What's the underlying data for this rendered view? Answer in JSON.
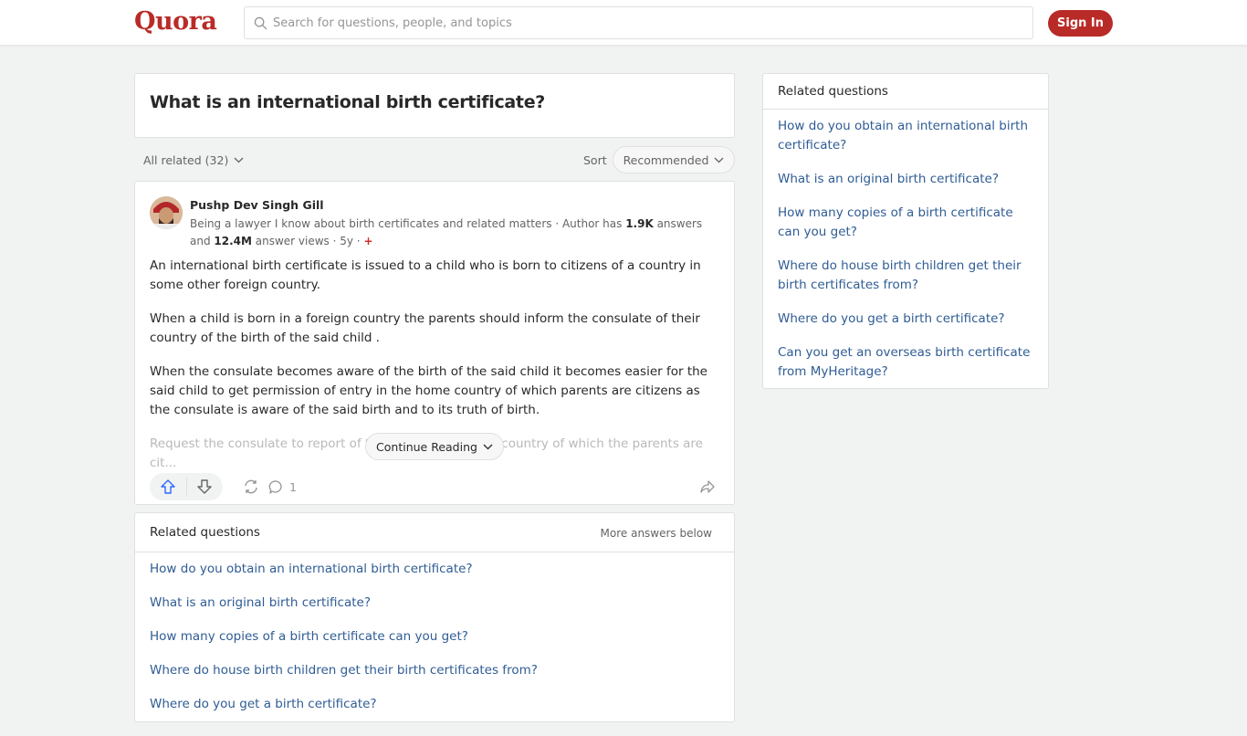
{
  "header": {
    "logo": "Quora",
    "search_placeholder": "Search for questions, people, and topics",
    "signin_label": "Sign In"
  },
  "question": {
    "title": "What is an international birth certificate?"
  },
  "filters": {
    "all_related": "All related (32)",
    "sort_label": "Sort",
    "sort_value": "Recommended"
  },
  "answer": {
    "author": "Pushp Dev Singh Gill",
    "credential_prefix": "Being a lawyer I know about birth certificates and related matters · Author has ",
    "answers_count": "1.9K",
    "credential_mid": " answers and ",
    "views_count": "12.4M",
    "credential_suffix": " answer views · 5y · ",
    "plus_badge": "+",
    "paragraphs": [
      "An international birth certificate is issued to a child who is born to citizens of a country in some other foreign country.",
      "When a child is born in a foreign country the parents should inform the consulate of their country of the birth of the said child .",
      "When the consulate becomes aware of the birth of the said child it becomes easier for the said child to get permission of entry in the home country of which parents are citizens as the consulate is aware of the said birth and to its truth of birth.",
      "Request the consulate to report of the birth to the home country of which the parents are cit..."
    ],
    "continue_label": "Continue Reading",
    "comment_count": "1"
  },
  "related_inline": {
    "title": "Related questions",
    "more": "More answers below",
    "items": [
      "How do you obtain an international birth certificate?",
      "What is an original birth certificate?",
      "How many copies of a birth certificate can you get?",
      "Where do house birth children get their birth certificates from?",
      "Where do you get a birth certificate?"
    ]
  },
  "related_side": {
    "title": "Related questions",
    "items": [
      "How do you obtain an international birth certificate?",
      "What is an original birth certificate?",
      "How many copies of a birth certificate can you get?",
      "Where do house birth children get their birth certificates from?",
      "Where do you get a birth certificate?",
      "Can you get an overseas birth certificate from MyHeritage?"
    ]
  }
}
